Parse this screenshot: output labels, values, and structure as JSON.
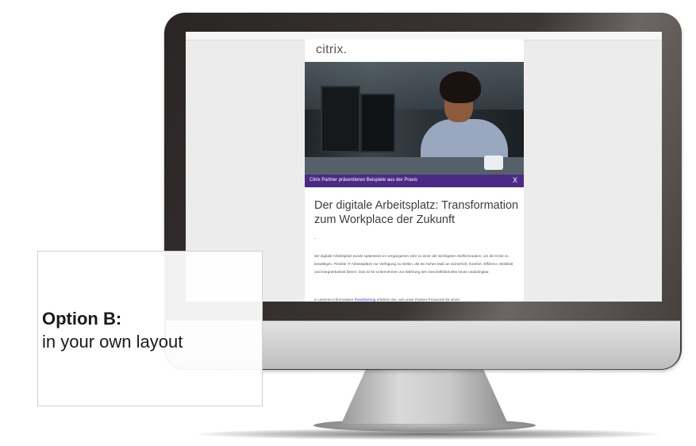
{
  "email": {
    "logo": "citrix.",
    "banner_text": "Citrix Partner präsentieren Beispiele aus der Praxis",
    "banner_close": "X",
    "headline": "Der digitale Arbeitsplatz: Transformation zum Workplace der Zukunft",
    "dash": "-",
    "body": "der digitale Arbeitsplatz wurde spätestens im vergangenen Jahr zu einer der wichtigsten Stellschrauben, um die Krise zu bewältigen. Flexible IT Arbeitsplätze zur Verfügung zu stellen, die ein hohes Maß an Sicherheit, Komfort, Effizienz, Mobilität und Integrierbarkeit bieten: Das ist für Unternehmen zur Wahrung des Geschäftsbetriebs heute unabdingbar.",
    "cta_before": "In unserem informativen ",
    "cta_link": "Praxisbeitrag",
    "cta_after": " erfahren Sie, wie unser Partner Provectus für einen"
  },
  "overlay": {
    "title": "Option B:",
    "subtitle": "in your own layout"
  }
}
